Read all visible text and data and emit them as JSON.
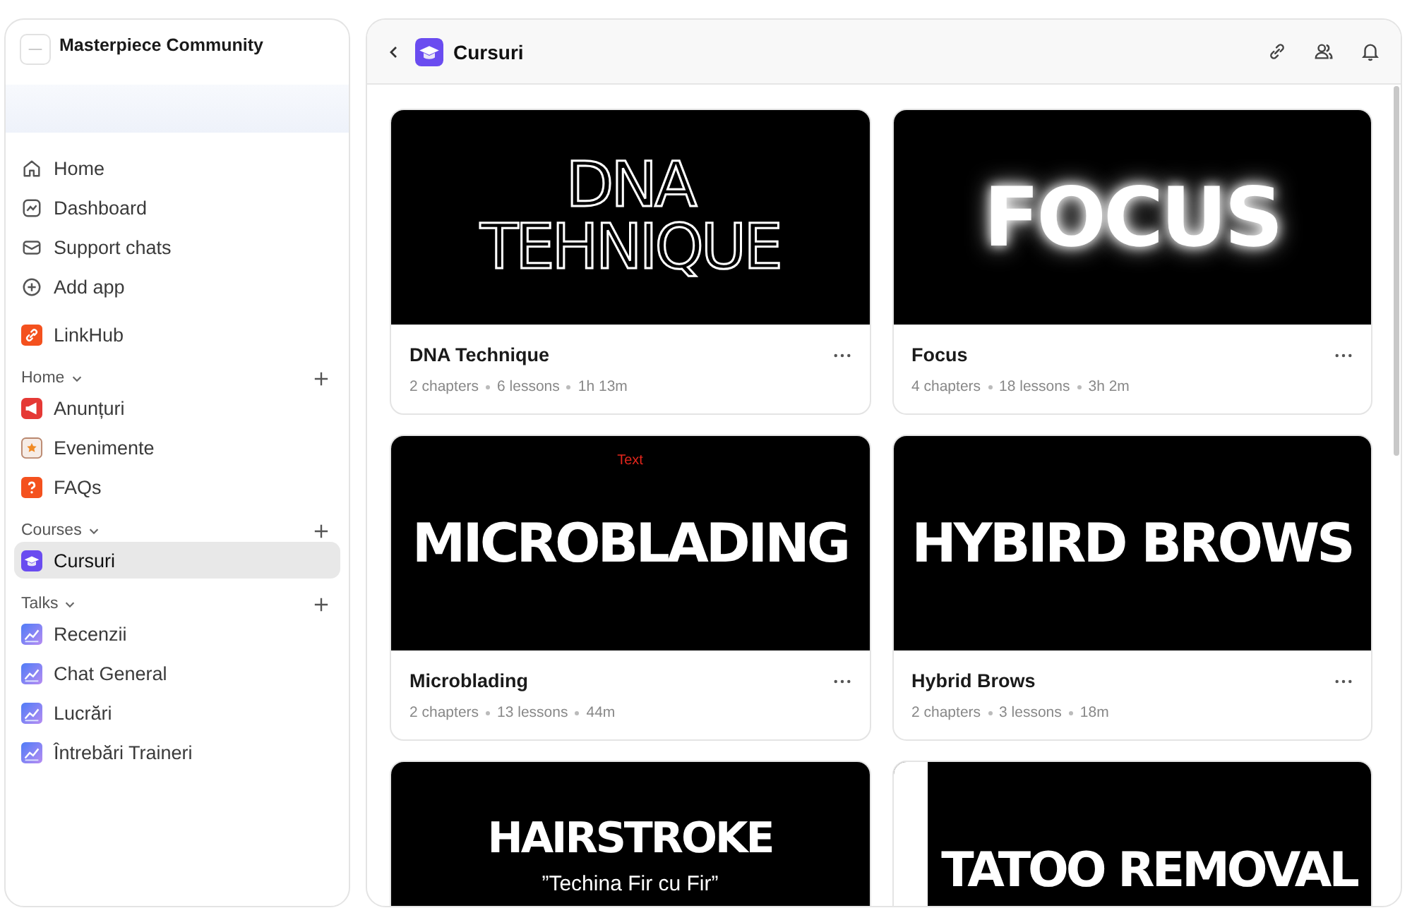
{
  "sidebar": {
    "community": {
      "name": "Masterpiece Community"
    },
    "nav": [
      {
        "label": "Home",
        "kind": "home",
        "selected": false
      },
      {
        "label": "Dashboard",
        "kind": "dashboard",
        "selected": false
      },
      {
        "label": "Support chats",
        "kind": "mail",
        "selected": false
      },
      {
        "label": "Add app",
        "kind": "add",
        "selected": false
      }
    ],
    "apps": [
      {
        "label": "LinkHub",
        "kind": "link",
        "selected": false
      }
    ],
    "sections": [
      {
        "title": "Home",
        "items": [
          {
            "label": "Anunțuri",
            "kind": "megaphone",
            "selected": false
          },
          {
            "label": "Evenimente",
            "kind": "star",
            "selected": false
          },
          {
            "label": "FAQs",
            "kind": "question",
            "selected": false
          }
        ]
      },
      {
        "title": "Courses",
        "items": [
          {
            "label": "Cursuri",
            "kind": "cap",
            "selected": true
          }
        ]
      },
      {
        "title": "Talks",
        "items": [
          {
            "label": "Recenzii",
            "kind": "chart",
            "selected": false
          },
          {
            "label": "Chat General",
            "kind": "chart",
            "selected": false
          },
          {
            "label": "Lucrări",
            "kind": "chart",
            "selected": false
          },
          {
            "label": "Întrebări Traineri",
            "kind": "chart",
            "selected": false
          }
        ]
      }
    ]
  },
  "header": {
    "title": "Cursuri"
  },
  "courses": [
    {
      "title": "DNA Technique",
      "meta": [
        "2 chapters",
        "6 lessons",
        "1h 13m"
      ],
      "cover": {
        "kind": "outline",
        "lines": [
          "DNA",
          "TEHNIQUE"
        ]
      }
    },
    {
      "title": "Focus",
      "meta": [
        "4 chapters",
        "18 lessons",
        "3h 2m"
      ],
      "cover": {
        "kind": "glow",
        "lines": [
          "FOCUS"
        ]
      }
    },
    {
      "title": "Microblading",
      "meta": [
        "2 chapters",
        "13 lessons",
        "44m"
      ],
      "cover": {
        "kind": "plain",
        "note": "Text",
        "lines": [
          "MICROBLADING"
        ]
      }
    },
    {
      "title": "Hybrid Brows",
      "meta": [
        "2 chapters",
        "3 lessons",
        "18m"
      ],
      "cover": {
        "kind": "plain",
        "lines": [
          "HYBIRD BROWS"
        ]
      }
    },
    {
      "cover": {
        "kind": "subtitled",
        "lines": [
          "HAIRSTROKE"
        ],
        "subtitle": "”Techina Fir cu Fir”"
      }
    },
    {
      "cover": {
        "kind": "offset",
        "lines": [
          "TATOO REMOVAL"
        ]
      }
    }
  ]
}
